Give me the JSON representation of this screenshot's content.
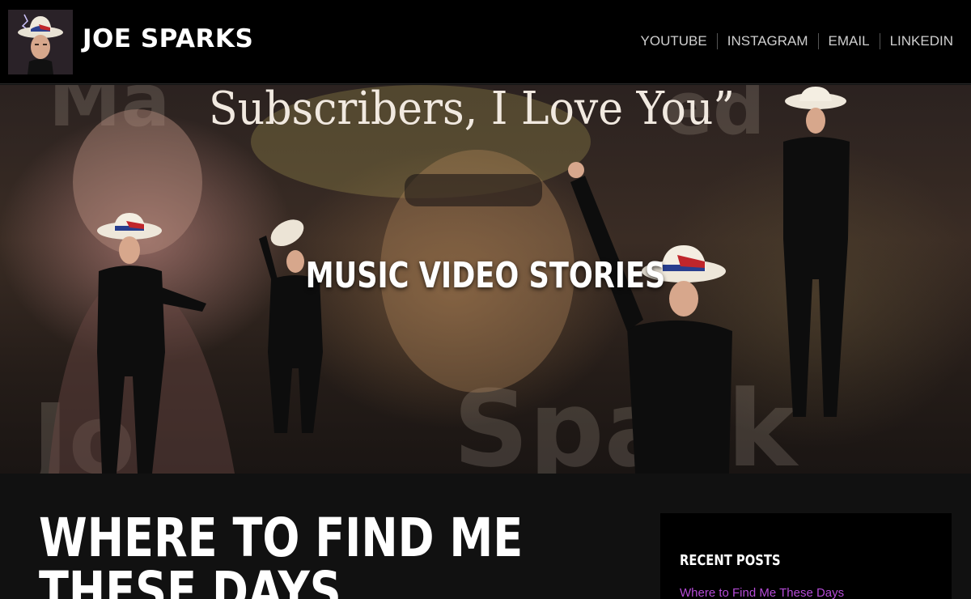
{
  "header": {
    "site_title": "JOE SPARKS",
    "nav": [
      {
        "label": "YOUTUBE"
      },
      {
        "label": "INSTAGRAM"
      },
      {
        "label": "EMAIL"
      },
      {
        "label": "LINKEDIN"
      }
    ]
  },
  "hero": {
    "title": "MUSIC VIDEO STORIES",
    "image_caption": "Subscribers, I Love You”"
  },
  "post": {
    "title": "WHERE TO FIND ME THESE DAYS"
  },
  "sidebar": {
    "widget_title": "RECENT POSTS",
    "recent_posts": [
      {
        "label": "Where to Find Me These Days"
      }
    ]
  },
  "colors": {
    "header_bg": "#000000",
    "page_bg": "#111111",
    "link_purple": "#b44bd6",
    "nav_text": "#cfcfcf"
  }
}
